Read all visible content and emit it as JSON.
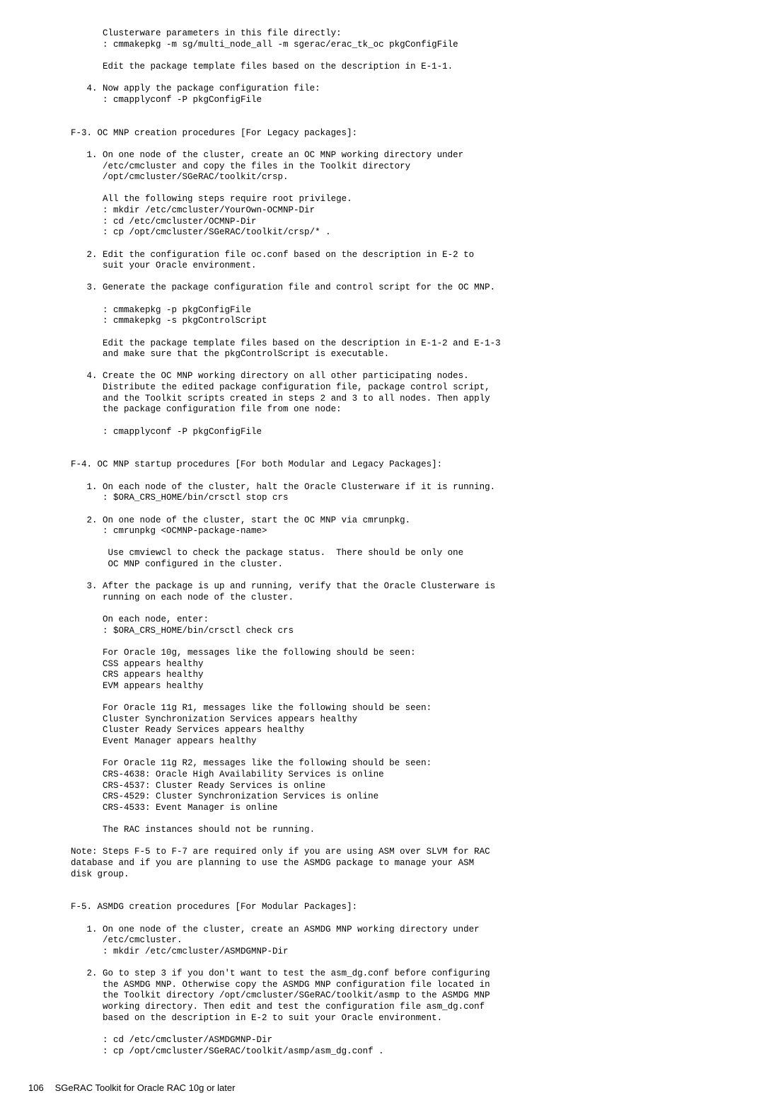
{
  "body": "      Clusterware parameters in this file directly:\n      : cmmakepkg -m sg/multi_node_all -m sgerac/erac_tk_oc pkgConfigFile\n\n      Edit the package template files based on the description in E-1-1.\n\n   4. Now apply the package configuration file:\n      : cmapplyconf -P pkgConfigFile\n\n\nF-3. OC MNP creation procedures [For Legacy packages]:\n\n   1. On one node of the cluster, create an OC MNP working directory under\n      /etc/cmcluster and copy the files in the Toolkit directory\n      /opt/cmcluster/SGeRAC/toolkit/crsp.\n\n      All the following steps require root privilege.\n      : mkdir /etc/cmcluster/YourOwn-OCMNP-Dir\n      : cd /etc/cmcluster/OCMNP-Dir\n      : cp /opt/cmcluster/SGeRAC/toolkit/crsp/* .\n\n   2. Edit the configuration file oc.conf based on the description in E-2 to\n      suit your Oracle environment.\n\n   3. Generate the package configuration file and control script for the OC MNP.\n\n      : cmmakepkg -p pkgConfigFile\n      : cmmakepkg -s pkgControlScript\n\n      Edit the package template files based on the description in E-1-2 and E-1-3\n      and make sure that the pkgControlScript is executable.\n\n   4. Create the OC MNP working directory on all other participating nodes.\n      Distribute the edited package configuration file, package control script,\n      and the Toolkit scripts created in steps 2 and 3 to all nodes. Then apply\n      the package configuration file from one node:\n\n      : cmapplyconf -P pkgConfigFile\n\n\nF-4. OC MNP startup procedures [For both Modular and Legacy Packages]:\n\n   1. On each node of the cluster, halt the Oracle Clusterware if it is running.\n      : $ORA_CRS_HOME/bin/crsctl stop crs\n\n   2. On one node of the cluster, start the OC MNP via cmrunpkg.\n      : cmrunpkg <OCMNP-package-name>\n\n       Use cmviewcl to check the package status.  There should be only one\n       OC MNP configured in the cluster.\n\n   3. After the package is up and running, verify that the Oracle Clusterware is\n      running on each node of the cluster.\n\n      On each node, enter:\n      : $ORA_CRS_HOME/bin/crsctl check crs\n\n      For Oracle 10g, messages like the following should be seen:\n      CSS appears healthy\n      CRS appears healthy\n      EVM appears healthy\n\n      For Oracle 11g R1, messages like the following should be seen:\n      Cluster Synchronization Services appears healthy\n      Cluster Ready Services appears healthy\n      Event Manager appears healthy\n\n      For Oracle 11g R2, messages like the following should be seen:\n      CRS-4638: Oracle High Availability Services is online\n      CRS-4537: Cluster Ready Services is online\n      CRS-4529: Cluster Synchronization Services is online\n      CRS-4533: Event Manager is online\n\n      The RAC instances should not be running.\n\nNote: Steps F-5 to F-7 are required only if you are using ASM over SLVM for RAC\ndatabase and if you are planning to use the ASMDG package to manage your ASM\ndisk group.\n\n\nF-5. ASMDG creation procedures [For Modular Packages]:\n\n   1. On one node of the cluster, create an ASMDG MNP working directory under\n      /etc/cmcluster.\n      : mkdir /etc/cmcluster/ASMDGMNP-Dir\n\n   2. Go to step 3 if you don't want to test the asm_dg.conf before configuring\n      the ASMDG MNP. Otherwise copy the ASMDG MNP configuration file located in\n      the Toolkit directory /opt/cmcluster/SGeRAC/toolkit/asmp to the ASMDG MNP\n      working directory. Then edit and test the configuration file asm_dg.conf\n      based on the description in E-2 to suit your Oracle environment.\n\n      : cd /etc/cmcluster/ASMDGMNP-Dir\n      : cp /opt/cmcluster/SGeRAC/toolkit/asmp/asm_dg.conf .",
  "footer": {
    "page": "106",
    "title": "SGeRAC Toolkit for Oracle RAC 10g or later"
  }
}
